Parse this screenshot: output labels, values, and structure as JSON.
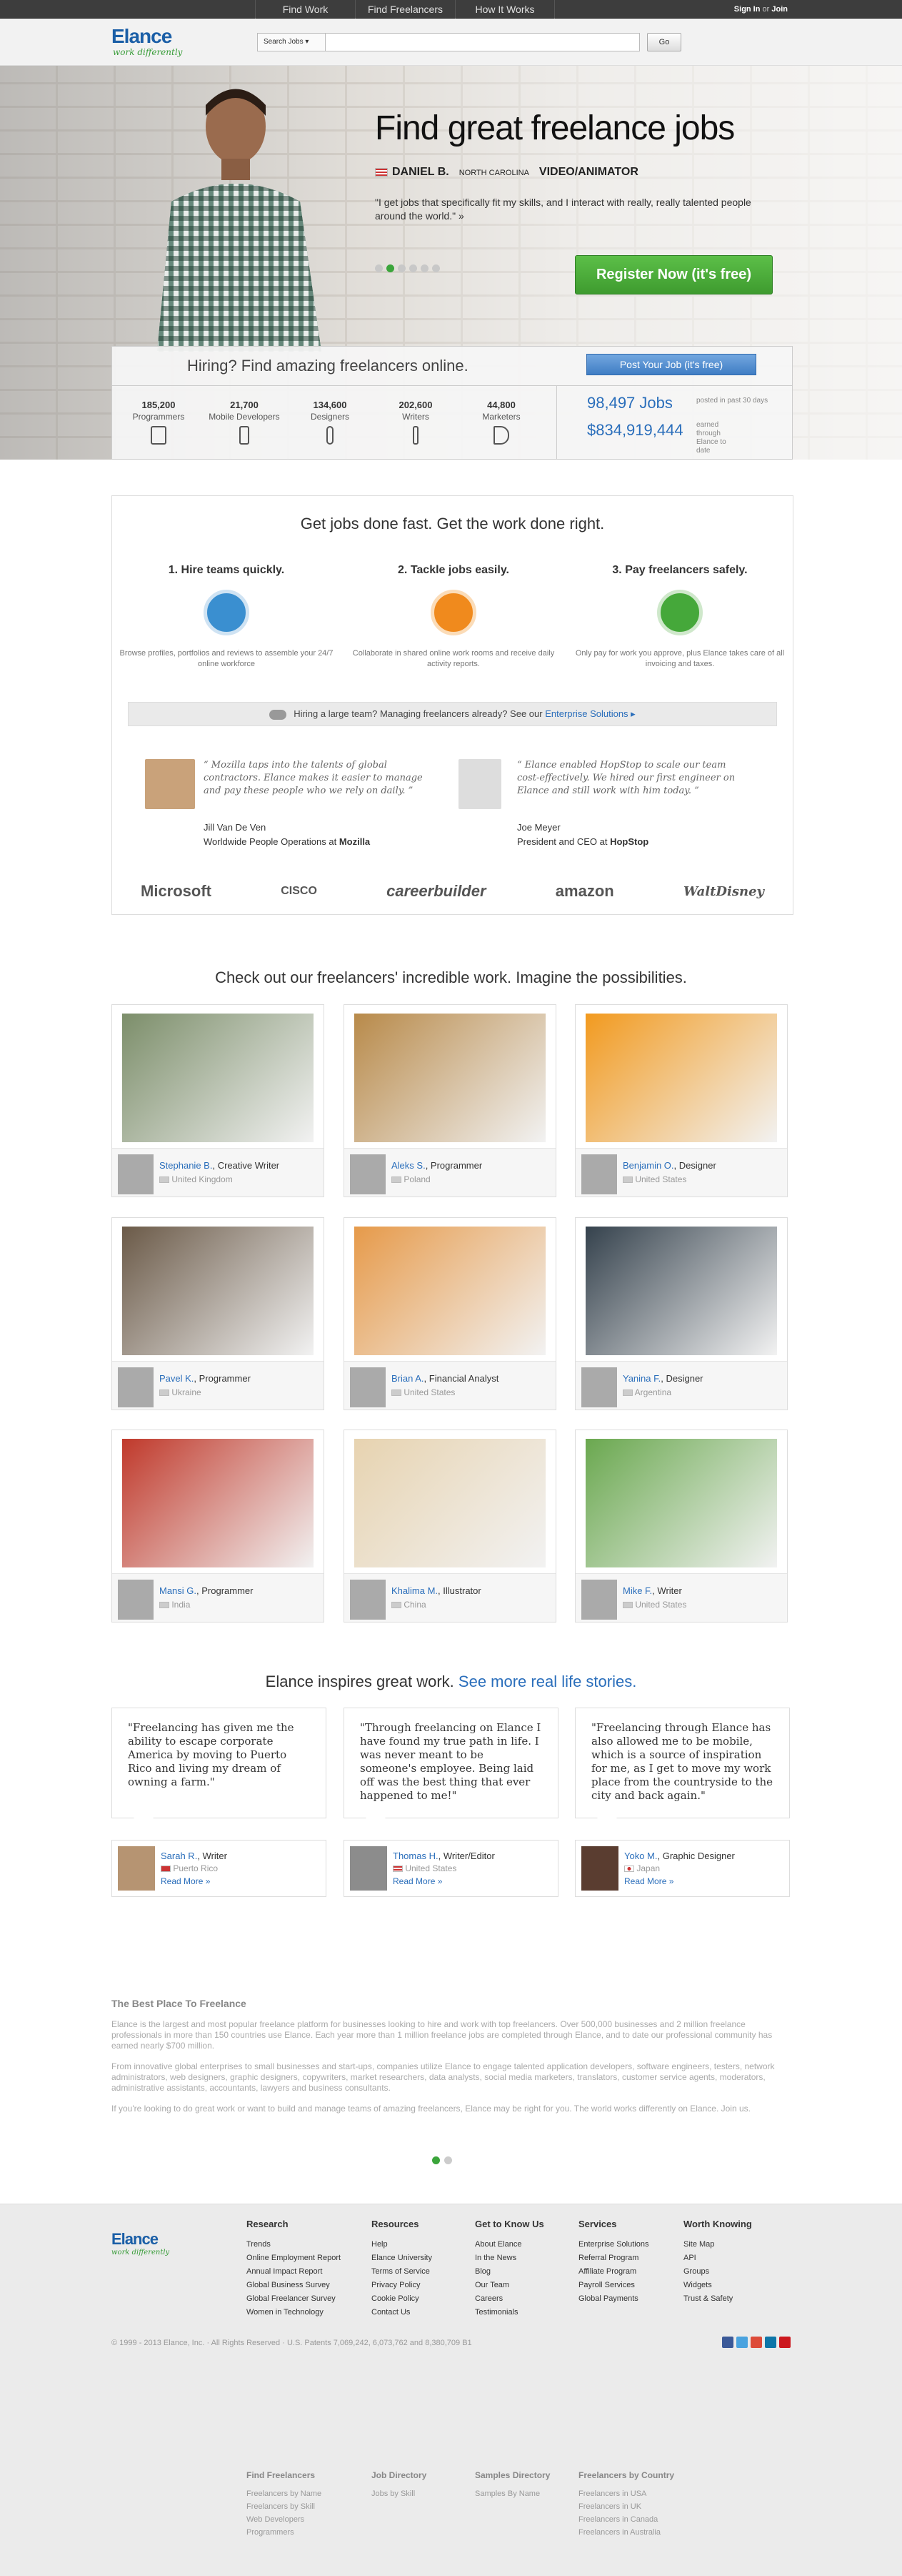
{
  "topnav": {
    "items": [
      "Find Work",
      "Find Freelancers",
      "How It Works"
    ],
    "signin": "Sign In",
    "or": "or",
    "join": "Join"
  },
  "header": {
    "logo": "Elance",
    "tagline": "work differently",
    "search_select": "Search Jobs ▾",
    "search_button": "Go"
  },
  "hero": {
    "title": "Find great freelance jobs",
    "name": "DANIEL B.",
    "location": "NORTH CAROLINA",
    "role": "VIDEO/ANIMATOR",
    "quote": "\"I get jobs that specifically fit my skills, and I interact with really, really talented people around the world.\" »",
    "register": "Register Now (it's free)"
  },
  "hire": {
    "title": "Hiring? Find amazing freelancers online.",
    "post_job": "Post Your Job (it's free)",
    "stats": [
      {
        "n": "185,200",
        "c": "Programmers"
      },
      {
        "n": "21,700",
        "c": "Mobile Developers"
      },
      {
        "n": "134,600",
        "c": "Designers"
      },
      {
        "n": "202,600",
        "c": "Writers"
      },
      {
        "n": "44,800",
        "c": "Marketers"
      }
    ],
    "jobs": "98,497 Jobs",
    "jobs_note": "posted in past 30 days",
    "earned": "$834,919,444",
    "earned_note": "earned through Elance to date"
  },
  "benefits": {
    "title": "Get jobs done fast. Get the work done right.",
    "steps": [
      {
        "h": "1. Hire teams quickly.",
        "p": "Browse profiles, portfolios and reviews to assemble your 24/7 online workforce"
      },
      {
        "h": "2. Tackle jobs easily.",
        "p": "Collaborate in shared online work rooms and receive daily activity reports."
      },
      {
        "h": "3. Pay freelancers safely.",
        "p": "Only pay for work you approve, plus Elance takes care of all invoicing and taxes."
      }
    ],
    "enterprise": "Hiring a large team? Managing freelancers already? See our",
    "enterprise_link": "Enterprise Solutions ▸",
    "testimonials": [
      {
        "q": "“ Mozilla taps into the talents of global contractors. Elance makes it easier to manage and pay these people who we rely on daily. ”",
        "name": "Jill Van De Ven",
        "title": "Worldwide People Operations at",
        "company": "Mozilla"
      },
      {
        "q": "“ Elance enabled HopStop to scale our team cost-effectively. We hired our first engineer on Elance and still work with him today. ”",
        "name": "Joe Meyer",
        "title": "President and CEO at",
        "company": "HopStop"
      }
    ],
    "logos": [
      "Microsoft",
      "CISCO",
      "careerbuilder",
      "amazon",
      "WaltDisney"
    ]
  },
  "showcase": {
    "title": "Check out our freelancers' incredible work. Imagine the possibilities.",
    "items": [
      {
        "name": "Stephanie B.",
        "role": "Creative Writer",
        "country": "United Kingdom",
        "color": "#7c8e6a"
      },
      {
        "name": "Aleks S.",
        "role": "Programmer",
        "country": "Poland",
        "color": "#b88a4a"
      },
      {
        "name": "Benjamin O.",
        "role": "Designer",
        "country": "United States",
        "color": "#f29a1f"
      },
      {
        "name": "Pavel K.",
        "role": "Programmer",
        "country": "Ukraine",
        "color": "#6b5a48"
      },
      {
        "name": "Brian A.",
        "role": "Financial Analyst",
        "country": "United States",
        "color": "#e69a4a"
      },
      {
        "name": "Yanina F.",
        "role": "Designer",
        "country": "Argentina",
        "color": "#35424d"
      },
      {
        "name": "Mansi G.",
        "role": "Programmer",
        "country": "India",
        "color": "#c0392b"
      },
      {
        "name": "Khalima M.",
        "role": "Illustrator",
        "country": "China",
        "color": "#e7d3b0"
      },
      {
        "name": "Mike F.",
        "role": "Writer",
        "country": "United States",
        "color": "#6aa84f"
      }
    ]
  },
  "stories": {
    "title": "Elance inspires great work.",
    "link": "See more real life stories.",
    "items": [
      {
        "q": "\"Freelancing has given me the ability to escape corporate America by moving to Puerto Rico and living my dream of owning a farm.\"",
        "name": "Sarah R.",
        "role": "Writer",
        "country": "Puerto Rico"
      },
      {
        "q": "\"Through freelancing on Elance I have found my true path in life. I was never meant to be someone's employee. Being laid off was the best thing that ever happened to me!\"",
        "name": "Thomas H.",
        "role": "Writer/Editor",
        "country": "United States"
      },
      {
        "q": "\"Freelancing through Elance has also allowed me to be mobile, which is a source of inspiration for me, as I get to move my work place from the countryside to the city and back again.\"",
        "name": "Yoko M.",
        "role": "Graphic Designer",
        "country": "Japan"
      }
    ],
    "read_more": "Read More »"
  },
  "about": {
    "title": "The Best Place To Freelance",
    "p1": "Elance is the largest and most popular freelance platform for businesses looking to hire and work with top freelancers. Over 500,000 businesses and 2 million freelance professionals in more than 150 countries use Elance. Each year more than 1 million freelance jobs are completed through Elance, and to date our professional community has earned nearly $700 million.",
    "p2": "From innovative global enterprises to small businesses and start-ups, companies utilize Elance to engage talented application developers, software engineers, testers, network administrators, web designers, graphic designers, copywriters, market researchers, data analysts, social media marketers, translators, customer service agents, moderators, administrative assistants, accountants, lawyers and business consultants.",
    "p3": "If you're looking to do great work or want to build and manage teams of amazing freelancers, Elance may be right for you. The world works differently on Elance. Join us."
  },
  "footer": {
    "cols": [
      {
        "h": "Research",
        "links": [
          "Trends",
          "Online Employment Report",
          "Annual Impact Report",
          "Global Business Survey",
          "Global Freelancer Survey",
          "Women in Technology"
        ]
      },
      {
        "h": "Resources",
        "links": [
          "Help",
          "Elance University",
          "Terms of Service",
          "Privacy Policy",
          "Cookie Policy",
          "Contact Us"
        ]
      },
      {
        "h": "Get to Know Us",
        "links": [
          "About Elance",
          "In the News",
          "Blog",
          "Our Team",
          "Careers",
          "Testimonials"
        ]
      },
      {
        "h": "Services",
        "links": [
          "Enterprise Solutions",
          "Referral Program",
          "Affiliate Program",
          "Payroll Services",
          "Global Payments"
        ]
      },
      {
        "h": "Worth Knowing",
        "links": [
          "Site Map",
          "API",
          "Groups",
          "Widgets",
          "Trust & Safety"
        ]
      }
    ],
    "copyright": "© 1999 - 2013 Elance, Inc. · All Rights Reserved · U.S. Patents 7,069,242, 6,073,762 and 8,380,709 B1",
    "cols2": [
      {
        "h": "Find Freelancers",
        "links": [
          "Freelancers by Name",
          "Freelancers by Skill",
          "Web Developers",
          "Programmers"
        ]
      },
      {
        "h": "Job Directory",
        "links": [
          "Jobs by Skill"
        ]
      },
      {
        "h": "Samples Directory",
        "links": [
          "Samples By Name"
        ]
      },
      {
        "h": "Freelancers by Country",
        "links": [
          "Freelancers in USA",
          "Freelancers in UK",
          "Freelancers in Canada",
          "Freelancers in Australia"
        ]
      }
    ],
    "social_colors": [
      "#3b5998",
      "#4aa3df",
      "#dd4b39",
      "#0e76a8",
      "#cc181e"
    ]
  }
}
